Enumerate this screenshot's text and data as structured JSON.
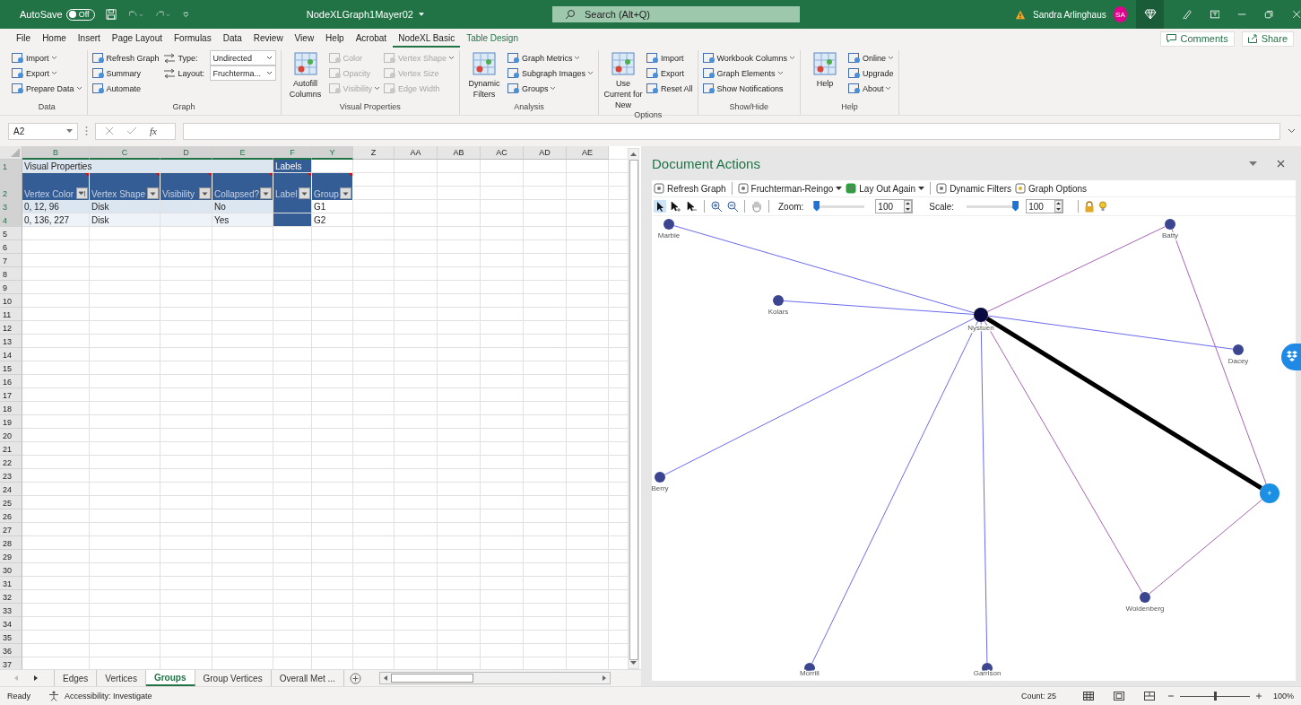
{
  "title_bar": {
    "autosave_label": "AutoSave",
    "autosave": {
      "on": false,
      "label": "Off"
    },
    "file_name": "NodeXLGraph1Mayer02",
    "search_placeholder": "Search (Alt+Q)",
    "user": "Sandra Arlinghaus",
    "initials": "SA"
  },
  "menu": [
    {
      "label": "File",
      "selected": false
    },
    {
      "label": "Home",
      "selected": false
    },
    {
      "label": "Insert",
      "selected": false
    },
    {
      "label": "Page Layout",
      "selected": false
    },
    {
      "label": "Formulas",
      "selected": false
    },
    {
      "label": "Data",
      "selected": false
    },
    {
      "label": "Review",
      "selected": false
    },
    {
      "label": "View",
      "selected": false
    },
    {
      "label": "Help",
      "selected": false
    },
    {
      "label": "Acrobat",
      "selected": false
    },
    {
      "label": "NodeXL Basic",
      "selected": true
    },
    {
      "label": "Table Design",
      "selected": false
    }
  ],
  "menu_buttons": [
    "Comments",
    "Share"
  ],
  "ribbon": [
    {
      "label": "Data",
      "columns": [
        [
          {
            "kind": "small",
            "label": "Import",
            "caret": true,
            "disabled": false
          },
          {
            "kind": "small",
            "label": "Export",
            "caret": true,
            "disabled": false
          },
          {
            "kind": "small",
            "label": "Prepare Data",
            "caret": true,
            "disabled": false
          }
        ]
      ]
    },
    {
      "label": "Graph",
      "columns": [
        [
          {
            "kind": "small",
            "label": "Refresh Graph",
            "caret": false,
            "disabled": false
          },
          {
            "kind": "small",
            "label": "Summary",
            "caret": false,
            "disabled": false
          },
          {
            "kind": "small",
            "label": "Automate",
            "caret": false,
            "disabled": false
          }
        ],
        [
          {
            "kind": "select",
            "label": "Type:",
            "value": "Undirected"
          },
          {
            "kind": "select",
            "label": "Layout:",
            "value": "Fruchterma..."
          }
        ]
      ]
    },
    {
      "label": "Visual Properties",
      "columns": [
        [
          {
            "kind": "large",
            "label": "Autofill Columns",
            "disabled": false
          }
        ],
        [
          {
            "kind": "small",
            "label": "Color",
            "caret": false,
            "disabled": true
          },
          {
            "kind": "small",
            "label": "Opacity",
            "caret": false,
            "disabled": true
          },
          {
            "kind": "small",
            "label": "Visibility",
            "caret": true,
            "disabled": true
          }
        ],
        [
          {
            "kind": "small",
            "label": "Vertex Shape",
            "caret": true,
            "disabled": true
          },
          {
            "kind": "small",
            "label": "Vertex Size",
            "caret": false,
            "disabled": true
          },
          {
            "kind": "small",
            "label": "Edge Width",
            "caret": false,
            "disabled": true
          }
        ]
      ]
    },
    {
      "label": "Analysis",
      "columns": [
        [
          {
            "kind": "large",
            "label": "Dynamic Filters",
            "disabled": false
          }
        ],
        [
          {
            "kind": "small",
            "label": "Graph Metrics",
            "caret": true,
            "disabled": false
          },
          {
            "kind": "small",
            "label": "Subgraph Images",
            "caret": true,
            "disabled": false
          },
          {
            "kind": "small",
            "label": "Groups",
            "caret": true,
            "disabled": false
          }
        ]
      ]
    },
    {
      "label": "Options",
      "columns": [
        [
          {
            "kind": "large",
            "label": "Use Current for New",
            "disabled": false
          }
        ],
        [
          {
            "kind": "small",
            "label": "Import",
            "caret": false,
            "disabled": false
          },
          {
            "kind": "small",
            "label": "Export",
            "caret": false,
            "disabled": false
          },
          {
            "kind": "small",
            "label": "Reset All",
            "caret": false,
            "disabled": false
          }
        ]
      ]
    },
    {
      "label": "Show/Hide",
      "columns": [
        [
          {
            "kind": "small",
            "label": "Workbook Columns",
            "caret": true,
            "disabled": false
          },
          {
            "kind": "small",
            "label": "Graph Elements",
            "caret": true,
            "disabled": false
          },
          {
            "kind": "small",
            "label": "Show Notifications",
            "caret": false,
            "disabled": false
          }
        ]
      ]
    },
    {
      "label": "Help",
      "columns": [
        [
          {
            "kind": "large",
            "label": "Help",
            "disabled": false
          }
        ],
        [
          {
            "kind": "small",
            "label": "Online",
            "caret": true,
            "disabled": false
          },
          {
            "kind": "small",
            "label": "Upgrade",
            "caret": false,
            "disabled": false
          },
          {
            "kind": "small",
            "label": "About",
            "caret": true,
            "disabled": false
          }
        ]
      ]
    }
  ],
  "formula_bar": {
    "name_box": "A2",
    "function_label": "fx"
  },
  "sheet": {
    "columns": [
      "B",
      "C",
      "D",
      "E",
      "F",
      "Y",
      "Z",
      "AA",
      "AB",
      "AC",
      "AD",
      "AE"
    ],
    "row_numbers": [
      "1",
      "2",
      "3",
      "4",
      "5",
      "6",
      "7",
      "8",
      "9",
      "10",
      "11",
      "12",
      "13",
      "14",
      "15",
      "16",
      "17",
      "18",
      "19",
      "20",
      "21",
      "22",
      "23",
      "24",
      "25",
      "26",
      "27",
      "28",
      "29",
      "30",
      "31",
      "32",
      "33",
      "34",
      "35",
      "36",
      "37"
    ],
    "section_titles": [
      "Visual Properties",
      "Labels"
    ],
    "table_headers": [
      {
        "label": "Vertex Color",
        "sorted": true
      },
      {
        "label": "Vertex Shape",
        "sorted": false
      },
      {
        "label": "Visibility",
        "sorted": false
      },
      {
        "label": "Collapsed?",
        "sorted": false
      },
      {
        "label": "Label",
        "sorted": false
      },
      {
        "label": "Group",
        "sorted": false
      }
    ],
    "table_rows": [
      {
        "vertex_color": "0, 12, 96",
        "vertex_shape": "Disk",
        "collapsed": "No",
        "group": "G1"
      },
      {
        "vertex_color": "0, 136, 227",
        "vertex_shape": "Disk",
        "collapsed": "Yes",
        "group": "G2"
      }
    ]
  },
  "sheet_tabs": [
    {
      "label": "Edges",
      "selected": false
    },
    {
      "label": "Vertices",
      "selected": false
    },
    {
      "label": "Groups",
      "selected": true
    },
    {
      "label": "Group Vertices",
      "selected": false
    },
    {
      "label": "Overall Met ...",
      "selected": false
    }
  ],
  "document_actions": {
    "title": "Document Actions",
    "toolbar": [
      {
        "kind": "button",
        "label": "Refresh Graph"
      },
      {
        "kind": "dropdown",
        "label": "Fruchterman-Reingo"
      },
      {
        "kind": "dropdown",
        "label": "Lay Out Again"
      },
      {
        "kind": "button",
        "label": "Dynamic Filters"
      },
      {
        "kind": "button",
        "label": "Graph Options"
      }
    ],
    "zoom": {
      "label": "Zoom:",
      "level": 0,
      "value": "100"
    },
    "scale": {
      "label": "Scale:",
      "level": 1,
      "value": "100"
    },
    "nodes": [
      {
        "kind": "vertex",
        "label": "Marble",
        "color": "#3c4690"
      },
      {
        "kind": "vertex",
        "label": "Batty",
        "color": "#3c4690"
      },
      {
        "kind": "vertex",
        "label": "Kolars",
        "color": "#3c4690"
      },
      {
        "kind": "hub",
        "label": "Nystuen",
        "color": "#0a0a40"
      },
      {
        "kind": "vertex",
        "label": "Dacey",
        "color": "#3c4690"
      },
      {
        "kind": "vertex",
        "label": "Berry",
        "color": "#3c4690"
      },
      {
        "kind": "group",
        "mark": "+",
        "color": "#1a8fe3"
      },
      {
        "kind": "vertex",
        "label": "Woldenberg",
        "color": "#3c4690"
      },
      {
        "kind": "vertex",
        "label": "Morrill",
        "color": "#3c4690"
      },
      {
        "kind": "vertex",
        "label": "Garrison",
        "color": "#3c4690"
      }
    ]
  },
  "status_bar": {
    "ready": "Ready",
    "accessibility": "Accessibility: Investigate",
    "count": "Count: 25",
    "zoom": "100%",
    "level": 0.5
  }
}
